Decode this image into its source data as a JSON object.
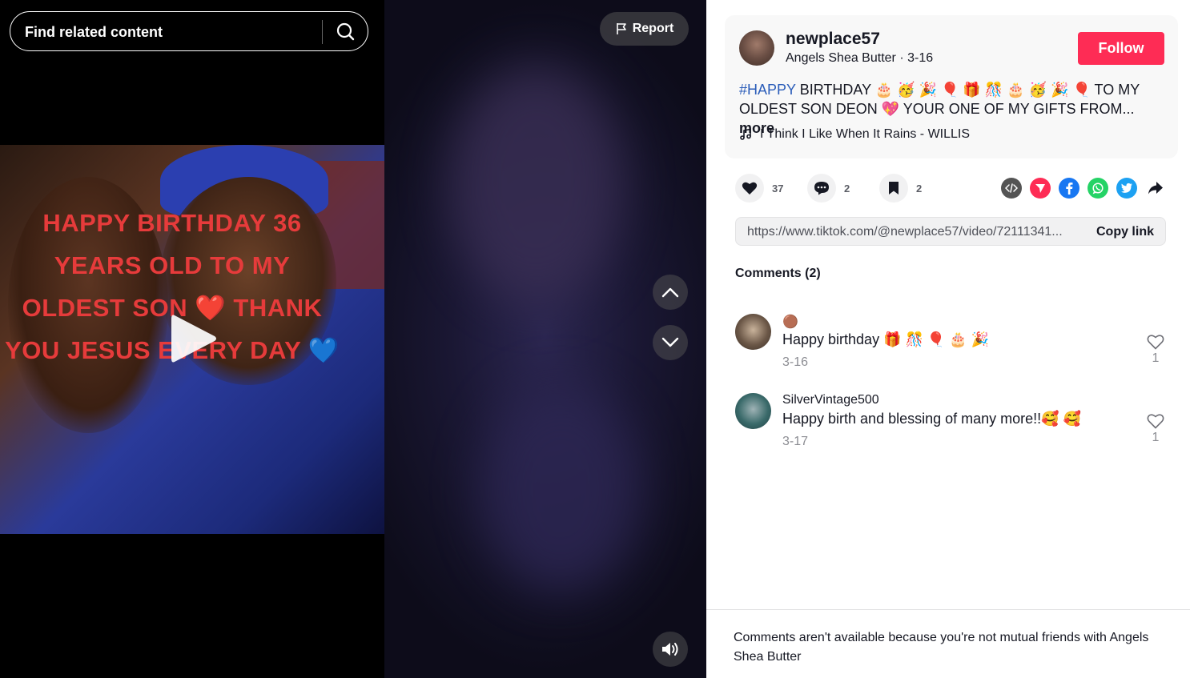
{
  "search": {
    "placeholder": "Find related content"
  },
  "video": {
    "report_label": "Report",
    "overlay_text": "HAPPY BIRTHDAY 36 YEARS OLD TO MY OLDEST SON ❤️ THANK YOU JESUS EVERY DAY 💙"
  },
  "author": {
    "username": "newplace57",
    "display_name": "Angels Shea Butter",
    "date": "3-16",
    "follow_label": "Follow"
  },
  "caption": {
    "hashtag": "#HAPPY",
    "text": " BIRTHDAY 🎂 🥳 🎉 🎈 🎁 🎊 🎂 🥳 🎉 🎈 TO MY OLDEST SON DEON 💖 YOUR ONE OF MY GIFTS FROM...",
    "more_label": "more"
  },
  "music": {
    "title": "I Think I Like When It Rains - WILLIS"
  },
  "stats": {
    "likes": "37",
    "comments": "2",
    "saves": "2"
  },
  "share": {
    "link": "https://www.tiktok.com/@newplace57/video/72111341...",
    "copy_label": "Copy link"
  },
  "comments": {
    "title": "Comments (2)",
    "items": [
      {
        "name": "🟤",
        "text": "Happy birthday 🎁 🎊 🎈 🎂 🎉",
        "date": "3-16",
        "likes": "1"
      },
      {
        "name": "SilverVintage500",
        "text": "Happy birth and blessing of many more!!🥰 🥰",
        "date": "3-17",
        "likes": "1"
      }
    ]
  },
  "footer": {
    "note": "Comments aren't available because you're not mutual friends with Angels Shea Butter"
  },
  "colors": {
    "accent": "#fe2c55",
    "hashtag": "#2b5db9",
    "facebook": "#1877f2",
    "whatsapp": "#25d366",
    "twitter": "#1da1f2",
    "repost": "#fe2c55"
  }
}
